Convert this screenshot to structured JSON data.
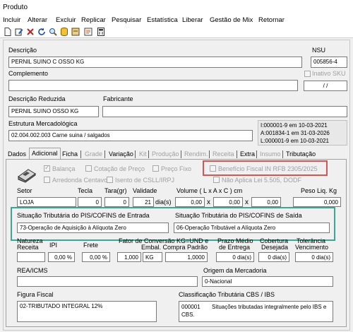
{
  "window": {
    "title": "Produto"
  },
  "menu": [
    "Incluir",
    "Alterar",
    "Excluir",
    "Replicar",
    "Pesquisar",
    "Estatística",
    "Liberar",
    "Gestão de Mix",
    "Retornar"
  ],
  "header": {
    "descricao_label": "Descrição",
    "descricao_value": "PERNIL SUINO C OSSO KG",
    "nsu_label": "NSU",
    "nsu_value": "005856-4",
    "complemento_label": "Complemento",
    "complemento_value": "",
    "inativo_sku_label": "Inativo SKU",
    "date_value": "/ /",
    "descricao_reduzida_label": "Descrição Reduzida",
    "descricao_reduzida_value": "PERNIL SUINO OSSO KG",
    "fabricante_label": "Fabricante",
    "fabricante_value": "",
    "estrutura_label": "Estrutura Mercadológica",
    "estrutura_value": "02.004.002.003 Carne suina / salgados",
    "audit_inclusao": "I:000001-9 em 10-03-2021",
    "audit_alteracao": "A:001834-1 em 31-03-2026",
    "audit_liberacao": "L:000001-9 em 10-03-2021"
  },
  "tabs": [
    {
      "label": "Dados",
      "state": "normal"
    },
    {
      "label": "Adicional",
      "state": "active"
    },
    {
      "label": "Ficha",
      "state": "normal"
    },
    {
      "label": "Grade",
      "state": "disabled"
    },
    {
      "label": "Variação",
      "state": "normal"
    },
    {
      "label": "Kit",
      "state": "disabled"
    },
    {
      "label": "Produção",
      "state": "disabled"
    },
    {
      "label": "Rendim.",
      "state": "disabled"
    },
    {
      "label": "Receita",
      "state": "disabled"
    },
    {
      "label": "Extra",
      "state": "normal"
    },
    {
      "label": "Insumo",
      "state": "disabled"
    },
    {
      "label": "Tributação",
      "state": "normal"
    }
  ],
  "checkboxes": {
    "balanca": "Balança",
    "cotacao_preco": "Cotação de Preço",
    "preco_fixo": "Preço Fixo",
    "beneficio_fiscal": "Benefício Fiscal IN RFB 2305/2025",
    "arredonda_centavos": "Arredonda Centavos",
    "isento_csll": "Isento de CSLL/IRPJ",
    "nao_aplica_lei": "Não Aplica Lei 5.505, DODF"
  },
  "fields": {
    "setor_label": "Setor",
    "setor_value": "LOJA",
    "tecla_label": "Tecla",
    "tecla_value": "0",
    "tara_label": "Tara(gr)",
    "tara_value": "0",
    "validade_label": "Validade",
    "validade_value": "21",
    "validade_unit": "dia(s)",
    "volume_label": "Volume ( L x A x C ) cm",
    "volume_l": "0,00",
    "volume_a": "0,00",
    "volume_c": "0,00",
    "volume_sep": "x",
    "peso_label": "Peso Liq. Kg",
    "peso_value": "0,000"
  },
  "pis_cofins": {
    "entrada_label": "Situação Tributária do PIS/COFINS de Entrada",
    "entrada_value": "73-Operação de Aquisição à Alíquota Zero",
    "saida_label": "Situação Tributária do PIS/COFINS de Saída",
    "saida_value": "06-Operação Tributável a Alíquota Zero"
  },
  "bottom": {
    "natureza_label1": "Natureza",
    "natureza_label2": "Receita",
    "natureza_value": "",
    "ipi_label": "IPI",
    "ipi_value": "0,00 %",
    "frete_label": "Frete",
    "frete_value": "0,00 %",
    "fator_label1": "Fator de Conversão KG=UND e",
    "fator_label2": "Embal. Compra Padrão",
    "fator_value": "1,000",
    "fator_unit": "KG",
    "fator_qtd": "1,0000",
    "prazo_label1": "Prazo Médio",
    "prazo_label2": "de Entrega",
    "prazo_value": "0 dia(s)",
    "cobertura_label1": "Cobertura",
    "cobertura_label2": "Desejada",
    "cobertura_value": "0 dia(s)",
    "tolerancia_label1": "Tolerância",
    "tolerancia_label2": "Vencimento",
    "tolerancia_value": "0 dia(s)",
    "rea_label": "REA/ICMS",
    "rea_value": "",
    "origem_label": "Origem da Mercadoria",
    "origem_value": "0-Nacional",
    "figura_label": "Figura Fiscal",
    "figura_value": "02-TRIBUTADO INTEGRAL 12%",
    "cbs_label": "Classificação Tributária CBS / IBS",
    "cbs_code": "000001",
    "cbs_line1": "Situações tributadas integralmente pelo IBS e",
    "cbs_line2": "CBS."
  },
  "highlights": {
    "red": "#d9534f",
    "teal": "#3aa893"
  }
}
